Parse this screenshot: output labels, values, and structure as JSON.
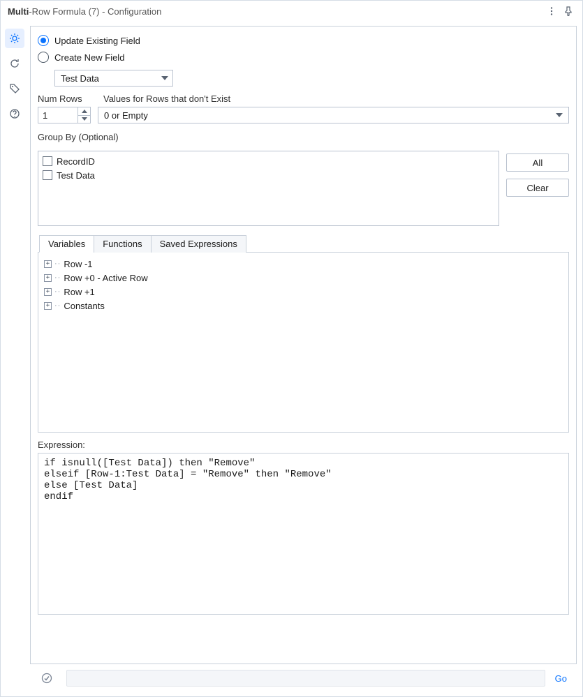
{
  "title": {
    "main": "Multi",
    "rest": "-Row Formula (7) - Configuration"
  },
  "sideIcons": {
    "gear": "gear-icon",
    "refresh": "refresh-icon",
    "tag": "tag-icon",
    "help": "help-icon"
  },
  "radio": {
    "update": "Update Existing Field",
    "create": "Create New  Field"
  },
  "fieldSelect": "Test Data",
  "numRowsLabel": "Num Rows",
  "numRowsValue": "1",
  "nullValsLabel": "Values for Rows that don't Exist",
  "nullValsValue": "0 or Empty",
  "groupByLabel": "Group By (Optional)",
  "groupByItems": [
    "RecordID",
    "Test Data"
  ],
  "buttons": {
    "all": "All",
    "clear": "Clear",
    "go": "Go"
  },
  "tabs": [
    "Variables",
    "Functions",
    "Saved Expressions"
  ],
  "tree": [
    "Row -1",
    "Row +0 - Active Row",
    "Row +1",
    "Constants"
  ],
  "expressionLabel": "Expression:",
  "expression": "if isnull([Test Data]) then \"Remove\"\nelseif [Row-1:Test Data] = \"Remove\" then \"Remove\"\nelse [Test Data]\nendif"
}
